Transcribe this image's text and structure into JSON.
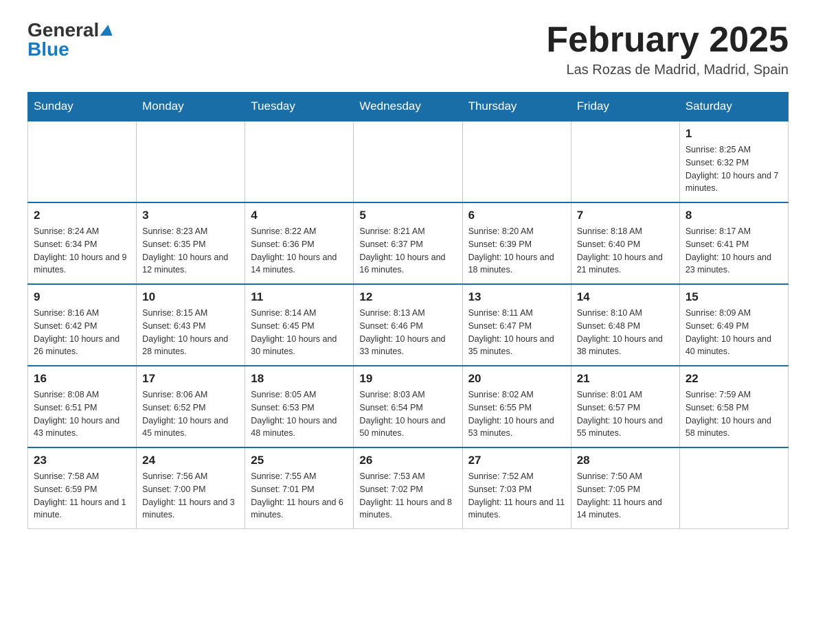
{
  "header": {
    "title": "February 2025",
    "location": "Las Rozas de Madrid, Madrid, Spain",
    "logo_general": "General",
    "logo_blue": "Blue"
  },
  "days_of_week": [
    "Sunday",
    "Monday",
    "Tuesday",
    "Wednesday",
    "Thursday",
    "Friday",
    "Saturday"
  ],
  "weeks": [
    [
      {
        "day": "",
        "info": ""
      },
      {
        "day": "",
        "info": ""
      },
      {
        "day": "",
        "info": ""
      },
      {
        "day": "",
        "info": ""
      },
      {
        "day": "",
        "info": ""
      },
      {
        "day": "",
        "info": ""
      },
      {
        "day": "1",
        "info": "Sunrise: 8:25 AM\nSunset: 6:32 PM\nDaylight: 10 hours and 7 minutes."
      }
    ],
    [
      {
        "day": "2",
        "info": "Sunrise: 8:24 AM\nSunset: 6:34 PM\nDaylight: 10 hours and 9 minutes."
      },
      {
        "day": "3",
        "info": "Sunrise: 8:23 AM\nSunset: 6:35 PM\nDaylight: 10 hours and 12 minutes."
      },
      {
        "day": "4",
        "info": "Sunrise: 8:22 AM\nSunset: 6:36 PM\nDaylight: 10 hours and 14 minutes."
      },
      {
        "day": "5",
        "info": "Sunrise: 8:21 AM\nSunset: 6:37 PM\nDaylight: 10 hours and 16 minutes."
      },
      {
        "day": "6",
        "info": "Sunrise: 8:20 AM\nSunset: 6:39 PM\nDaylight: 10 hours and 18 minutes."
      },
      {
        "day": "7",
        "info": "Sunrise: 8:18 AM\nSunset: 6:40 PM\nDaylight: 10 hours and 21 minutes."
      },
      {
        "day": "8",
        "info": "Sunrise: 8:17 AM\nSunset: 6:41 PM\nDaylight: 10 hours and 23 minutes."
      }
    ],
    [
      {
        "day": "9",
        "info": "Sunrise: 8:16 AM\nSunset: 6:42 PM\nDaylight: 10 hours and 26 minutes."
      },
      {
        "day": "10",
        "info": "Sunrise: 8:15 AM\nSunset: 6:43 PM\nDaylight: 10 hours and 28 minutes."
      },
      {
        "day": "11",
        "info": "Sunrise: 8:14 AM\nSunset: 6:45 PM\nDaylight: 10 hours and 30 minutes."
      },
      {
        "day": "12",
        "info": "Sunrise: 8:13 AM\nSunset: 6:46 PM\nDaylight: 10 hours and 33 minutes."
      },
      {
        "day": "13",
        "info": "Sunrise: 8:11 AM\nSunset: 6:47 PM\nDaylight: 10 hours and 35 minutes."
      },
      {
        "day": "14",
        "info": "Sunrise: 8:10 AM\nSunset: 6:48 PM\nDaylight: 10 hours and 38 minutes."
      },
      {
        "day": "15",
        "info": "Sunrise: 8:09 AM\nSunset: 6:49 PM\nDaylight: 10 hours and 40 minutes."
      }
    ],
    [
      {
        "day": "16",
        "info": "Sunrise: 8:08 AM\nSunset: 6:51 PM\nDaylight: 10 hours and 43 minutes."
      },
      {
        "day": "17",
        "info": "Sunrise: 8:06 AM\nSunset: 6:52 PM\nDaylight: 10 hours and 45 minutes."
      },
      {
        "day": "18",
        "info": "Sunrise: 8:05 AM\nSunset: 6:53 PM\nDaylight: 10 hours and 48 minutes."
      },
      {
        "day": "19",
        "info": "Sunrise: 8:03 AM\nSunset: 6:54 PM\nDaylight: 10 hours and 50 minutes."
      },
      {
        "day": "20",
        "info": "Sunrise: 8:02 AM\nSunset: 6:55 PM\nDaylight: 10 hours and 53 minutes."
      },
      {
        "day": "21",
        "info": "Sunrise: 8:01 AM\nSunset: 6:57 PM\nDaylight: 10 hours and 55 minutes."
      },
      {
        "day": "22",
        "info": "Sunrise: 7:59 AM\nSunset: 6:58 PM\nDaylight: 10 hours and 58 minutes."
      }
    ],
    [
      {
        "day": "23",
        "info": "Sunrise: 7:58 AM\nSunset: 6:59 PM\nDaylight: 11 hours and 1 minute."
      },
      {
        "day": "24",
        "info": "Sunrise: 7:56 AM\nSunset: 7:00 PM\nDaylight: 11 hours and 3 minutes."
      },
      {
        "day": "25",
        "info": "Sunrise: 7:55 AM\nSunset: 7:01 PM\nDaylight: 11 hours and 6 minutes."
      },
      {
        "day": "26",
        "info": "Sunrise: 7:53 AM\nSunset: 7:02 PM\nDaylight: 11 hours and 8 minutes."
      },
      {
        "day": "27",
        "info": "Sunrise: 7:52 AM\nSunset: 7:03 PM\nDaylight: 11 hours and 11 minutes."
      },
      {
        "day": "28",
        "info": "Sunrise: 7:50 AM\nSunset: 7:05 PM\nDaylight: 11 hours and 14 minutes."
      },
      {
        "day": "",
        "info": ""
      }
    ]
  ]
}
